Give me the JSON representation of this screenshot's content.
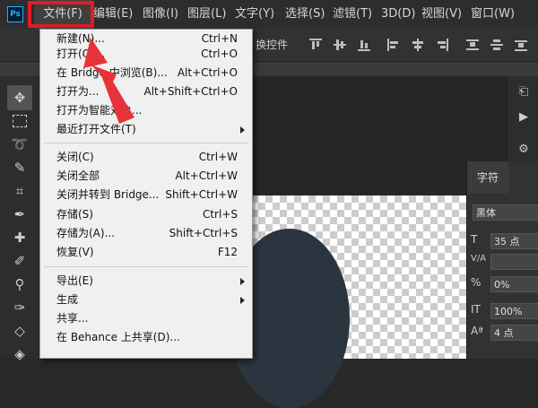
{
  "app": {
    "logo_text": "Ps"
  },
  "menubar": {
    "items": [
      {
        "label": "文件(F)",
        "active": true
      },
      {
        "label": "编辑(E)"
      },
      {
        "label": "图像(I)"
      },
      {
        "label": "图层(L)"
      },
      {
        "label": "文字(Y)"
      },
      {
        "label": "选择(S)"
      },
      {
        "label": "滤镜(T)"
      },
      {
        "label": "3D(D)"
      },
      {
        "label": "视图(V)"
      },
      {
        "label": "窗口(W)"
      }
    ]
  },
  "options": {
    "transform_label": "换控件"
  },
  "file_menu": {
    "items": [
      {
        "label": "新建(N)...",
        "shortcut": "Ctrl+N"
      },
      {
        "label": "打开(O)...",
        "shortcut": "Ctrl+O"
      },
      {
        "label": "在 Bridge 中浏览(B)...",
        "shortcut": "Alt+Ctrl+O"
      },
      {
        "label": "打开为...",
        "shortcut": "Alt+Shift+Ctrl+O"
      },
      {
        "label": "打开为智能对象...",
        "shortcut": ""
      },
      {
        "label": "最近打开文件(T)",
        "shortcut": "",
        "submenu": true
      },
      {
        "label": "关闭(C)",
        "shortcut": "Ctrl+W"
      },
      {
        "label": "关闭全部",
        "shortcut": "Alt+Ctrl+W"
      },
      {
        "label": "关闭并转到 Bridge...",
        "shortcut": "Shift+Ctrl+W"
      },
      {
        "label": "存储(S)",
        "shortcut": "Ctrl+S"
      },
      {
        "label": "存储为(A)...",
        "shortcut": "Shift+Ctrl+S"
      },
      {
        "label": "恢复(V)",
        "shortcut": "F12"
      },
      {
        "label": "导出(E)",
        "shortcut": "",
        "submenu": true
      },
      {
        "label": "生成",
        "shortcut": "",
        "submenu": true
      },
      {
        "label": "共享...",
        "shortcut": ""
      },
      {
        "label": "在 Behance 上共享(D)...",
        "shortcut": ""
      }
    ]
  },
  "character_panel": {
    "tab_label": "字符",
    "font_family": "黑体",
    "font_size": "35 点",
    "tracking": "0%",
    "vertical_scale": "100%",
    "baseline": "4 点"
  },
  "colors": {
    "highlight": "#e31b23",
    "accent": "#31a8ff"
  }
}
